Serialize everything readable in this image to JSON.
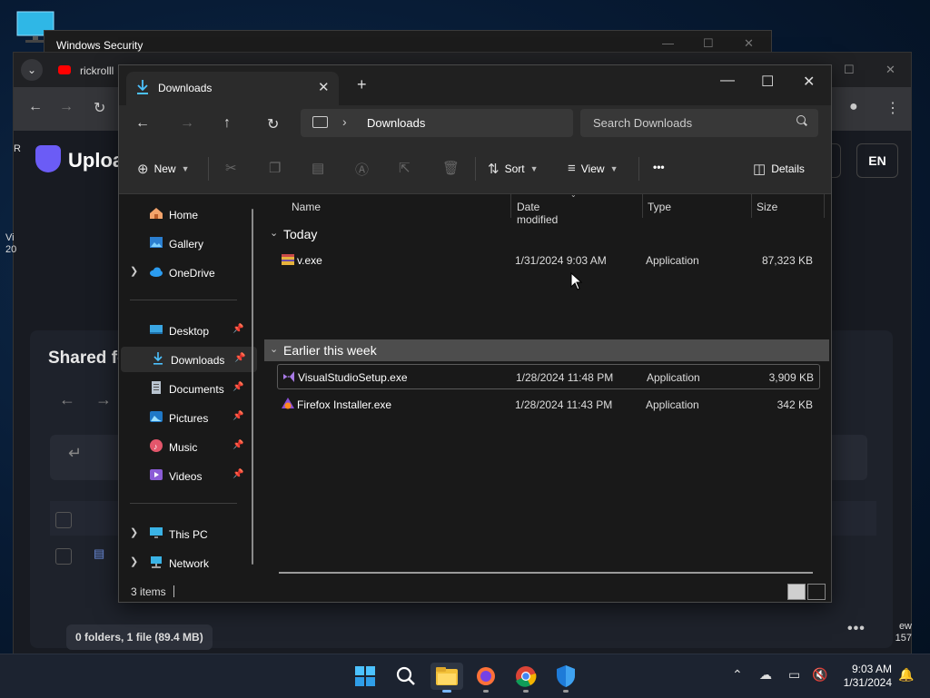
{
  "windows_security": {
    "title": "Windows Security"
  },
  "browser": {
    "tab_title": "rickrolll",
    "logo_text": "Uploa",
    "lang_button": "EN",
    "shared_title": "Shared fo",
    "side_r": "R",
    "side_vi": "Vi",
    "side_20": "20",
    "side_ew": "ew",
    "side_157": "157",
    "folder_summary": "0 folders, 1 file (89.4 MB)"
  },
  "explorer": {
    "tab_title": "Downloads",
    "breadcrumb": "Downloads",
    "search_placeholder": "Search Downloads",
    "toolbar": {
      "new_label": "New",
      "sort_label": "Sort",
      "view_label": "View",
      "more_label": "•••",
      "details_label": "Details"
    },
    "nav": {
      "home": "Home",
      "gallery": "Gallery",
      "onedrive": "OneDrive",
      "desktop": "Desktop",
      "downloads": "Downloads",
      "documents": "Documents",
      "pictures": "Pictures",
      "music": "Music",
      "videos": "Videos",
      "thispc": "This PC",
      "network": "Network"
    },
    "columns": {
      "name": "Name",
      "date": "Date modified",
      "type": "Type",
      "size": "Size"
    },
    "groups": {
      "today": "Today",
      "earlier": "Earlier this week"
    },
    "files": [
      {
        "name": "v.exe",
        "date": "1/31/2024 9:03 AM",
        "type": "Application",
        "size": "87,323 KB"
      },
      {
        "name": "VisualStudioSetup.exe",
        "date": "1/28/2024 11:48 PM",
        "type": "Application",
        "size": "3,909 KB"
      },
      {
        "name": "Firefox Installer.exe",
        "date": "1/28/2024 11:43 PM",
        "type": "Application",
        "size": "342 KB"
      }
    ],
    "status": {
      "count": "3 items"
    }
  },
  "taskbar": {
    "time": "9:03 AM",
    "date": "1/31/2024"
  },
  "colors": {
    "accent": "#4cc2ff",
    "folder": "#f3c13a"
  }
}
